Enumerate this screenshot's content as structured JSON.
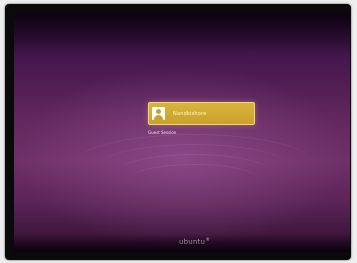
{
  "login": {
    "user_name": "Nandkishore",
    "guest_label": "Guest Session"
  },
  "branding": {
    "logo_text": "ubuntu",
    "logo_mark": "®"
  },
  "icons": {
    "user": "user-avatar-icon"
  },
  "colors": {
    "screen_purple": "#63285f",
    "selection_gold": "#d9b43a",
    "bezel": "#0b0a0b"
  }
}
